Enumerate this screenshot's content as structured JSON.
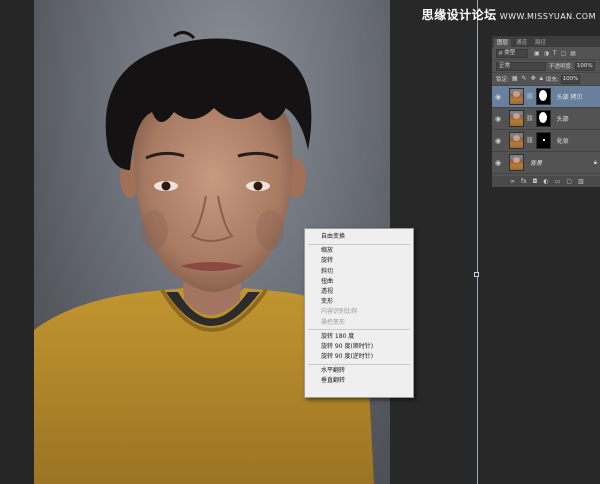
{
  "watermark": {
    "text": "思缘设计论坛",
    "site": "WWW.MISSYUAN.COM"
  },
  "layers_panel": {
    "tabs": [
      {
        "label": "图层",
        "active": true
      },
      {
        "label": "通道",
        "active": false
      },
      {
        "label": "路径",
        "active": false
      }
    ],
    "filter": {
      "kind_label": "类型",
      "icons": [
        "image-filter",
        "adjust-filter",
        "type-filter",
        "shape-filter",
        "smart-filter"
      ]
    },
    "blend": {
      "mode": "正常",
      "opacity_label": "不透明度:",
      "opacity_value": "100%"
    },
    "lock": {
      "label": "锁定:",
      "fill_label": "填充:",
      "fill_value": "100%"
    },
    "layers": [
      {
        "name": "头部 拷贝",
        "selected": true,
        "mask": "white-head",
        "visible": true
      },
      {
        "name": "头部",
        "selected": false,
        "mask": "white-head",
        "visible": true
      },
      {
        "name": "化妆",
        "selected": false,
        "mask": "dot",
        "visible": true
      },
      {
        "name": "背景",
        "selected": false,
        "mask": "none",
        "visible": true,
        "locked": true
      }
    ],
    "footer_icons": [
      "link-icon",
      "fx-icon",
      "add-mask-icon",
      "adjustment-icon",
      "group-icon",
      "new-layer-icon",
      "trash-icon"
    ],
    "footer_text": {
      "link": "∞",
      "fx": "fx",
      "mask": "◘",
      "adj": "◐",
      "group": "▭",
      "new": "▢",
      "trash": "▥"
    }
  },
  "context_menu": {
    "groups": [
      [
        {
          "label": "自由变换",
          "enabled": true
        }
      ],
      [
        {
          "label": "缩放",
          "enabled": true
        },
        {
          "label": "旋转",
          "enabled": true
        },
        {
          "label": "斜切",
          "enabled": true
        },
        {
          "label": "扭曲",
          "enabled": true
        },
        {
          "label": "透视",
          "enabled": true
        },
        {
          "label": "变形",
          "enabled": true
        },
        {
          "label": "内容识别比例",
          "enabled": false
        },
        {
          "label": "操控变形",
          "enabled": false
        }
      ],
      [
        {
          "label": "旋转 180 度",
          "enabled": true
        },
        {
          "label": "旋转 90 度(顺时针)",
          "enabled": true
        },
        {
          "label": "旋转 90 度(逆时针)",
          "enabled": true
        }
      ],
      [
        {
          "label": "水平翻转",
          "enabled": true
        },
        {
          "label": "垂直翻转",
          "enabled": true
        }
      ]
    ]
  },
  "colors": {
    "canvas_bg": "#282828",
    "panel_bg": "#535353",
    "selected_layer": "#68809d",
    "menu_bg": "#efefef",
    "sweater": "#b48a2e"
  }
}
